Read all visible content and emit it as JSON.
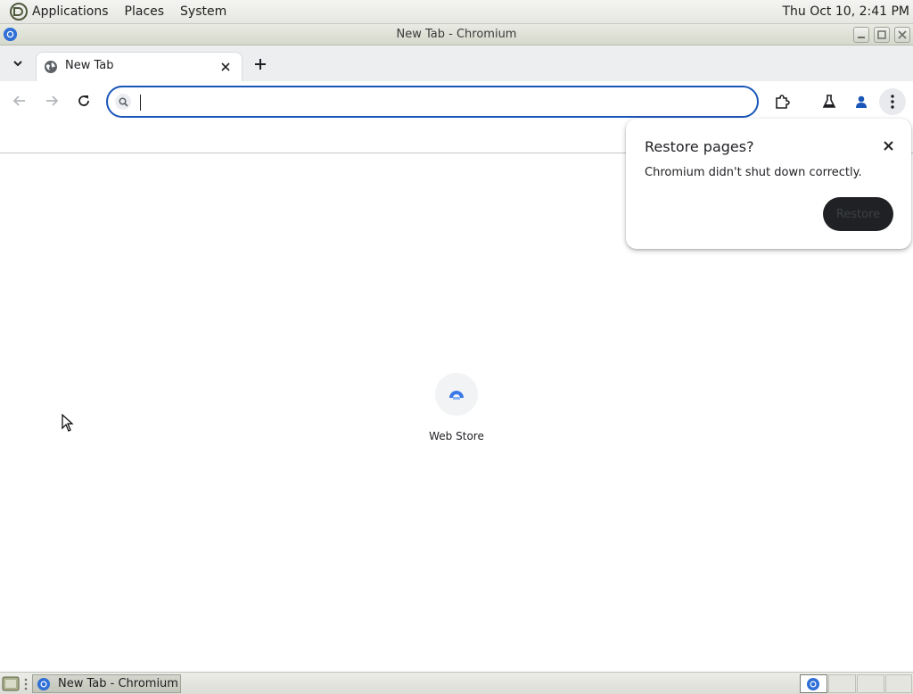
{
  "top_panel": {
    "menus": [
      "Applications",
      "Places",
      "System"
    ],
    "clock": "Thu Oct 10,  2:41 PM"
  },
  "window": {
    "title": "New Tab - Chromium"
  },
  "tabs": [
    {
      "label": "New Tab"
    }
  ],
  "omnibox": {
    "value": "",
    "placeholder": ""
  },
  "restore_popup": {
    "title": "Restore pages?",
    "message": "Chromium didn't shut down correctly.",
    "button_label": "Restore"
  },
  "shortcuts": [
    {
      "label": "Web Store",
      "icon": "web-store-icon"
    }
  ],
  "taskbar": {
    "task_label": "New Tab - Chromium"
  },
  "colors": {
    "omnibox_focus": "#1a56b8",
    "restore_button_bg": "#202124",
    "profile_icon": "#1a56b8"
  }
}
